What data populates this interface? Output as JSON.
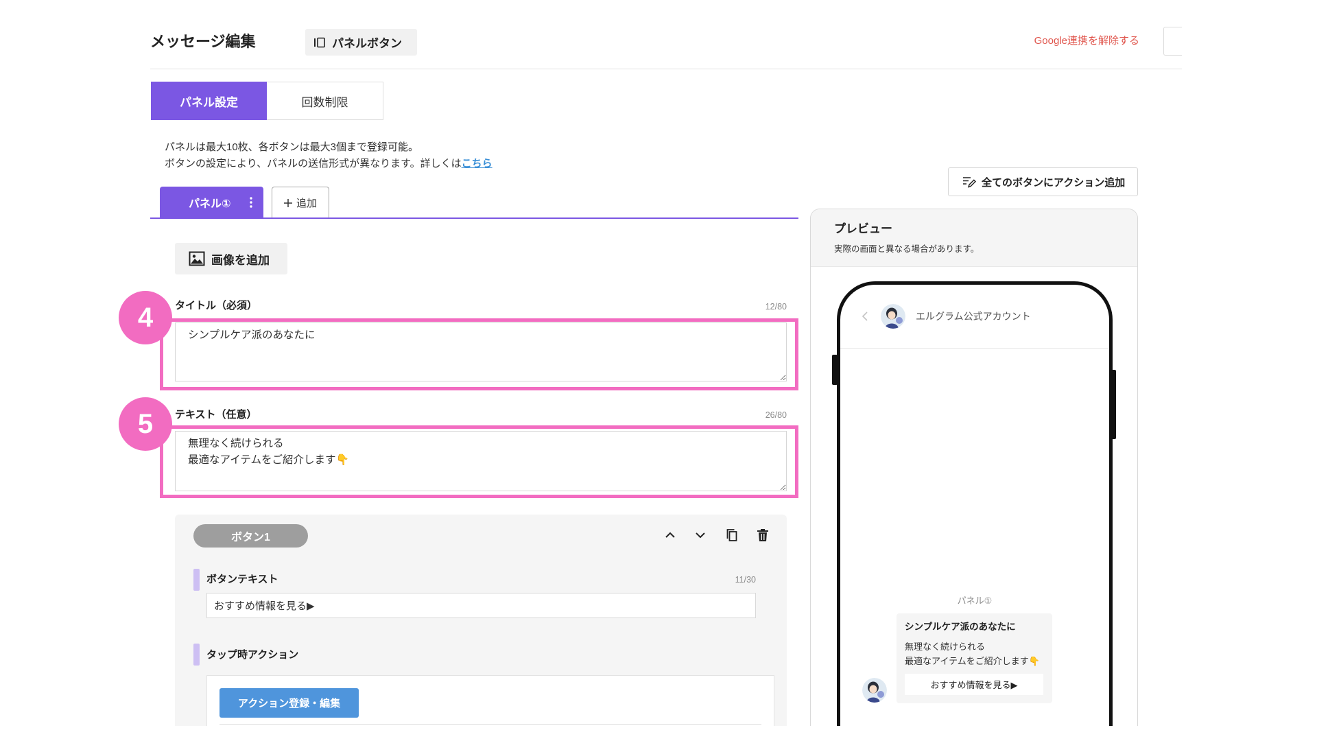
{
  "header": {
    "title": "メッセージ編集",
    "panel_button_label": "パネルボタン",
    "google_unlink_label": "Google連携を解除する"
  },
  "tabs": [
    {
      "label": "パネル設定",
      "active": true
    },
    {
      "label": "回数制限",
      "active": false
    }
  ],
  "info": {
    "line1": "パネルは最大10枚、各ボタンは最大3個まで登録可能。",
    "line2": "ボタンの設定により、パネルの送信形式が異なります。詳しくは",
    "link_label": "こちら"
  },
  "add_action_all_label": "全てのボタンにアクション追加",
  "panel_tabs": {
    "items": [
      {
        "label": "パネル①",
        "active": true
      }
    ],
    "add_label": "追加"
  },
  "add_image_label": "画像を追加",
  "title_field": {
    "step": "4",
    "label": "タイトル（必須）",
    "counter": "12/80",
    "value": "シンプルケア派のあなたに"
  },
  "text_field": {
    "step": "5",
    "label": "テキスト（任意）",
    "counter": "26/80",
    "value": "無理なく続けられる\n最適なアイテムをご紹介します👇"
  },
  "button_card": {
    "badge": "ボタン1",
    "text_label": "ボタンテキスト",
    "text_counter": "11/30",
    "text_value": "おすすめ情報を見る▶",
    "action_label": "タップ時アクション",
    "action_button_label": "アクション登録・編集"
  },
  "preview": {
    "title": "プレビュー",
    "note": "実際の画面と異なる場合があります。",
    "account_name": "エルグラム公式アカウント",
    "panel_label": "パネル①",
    "message": {
      "title": "シンプルケア派のあなたに",
      "text": "無理なく続けられる\n最適なアイテムをご紹介します👇",
      "button_label": "おすすめ情報を見る▶"
    }
  },
  "icons": {
    "panel_button": "panel-layout-icon",
    "add_action_all": "list-edit-icon",
    "panel_menu": "kebab-menu-icon",
    "add_panel": "plus-icon",
    "add_image": "image-icon",
    "move_up": "chevron-up-icon",
    "move_down": "chevron-down-icon",
    "duplicate": "copy-icon",
    "delete": "trash-icon",
    "back": "chevron-left-icon"
  },
  "colors": {
    "accent": "#7b57e3",
    "highlight": "#f26cc1",
    "link": "#3a8fd6",
    "danger": "#e0554c",
    "action_button": "#4f95dc",
    "badge": "#9e9e9e",
    "label_bar": "#cdbff3"
  }
}
